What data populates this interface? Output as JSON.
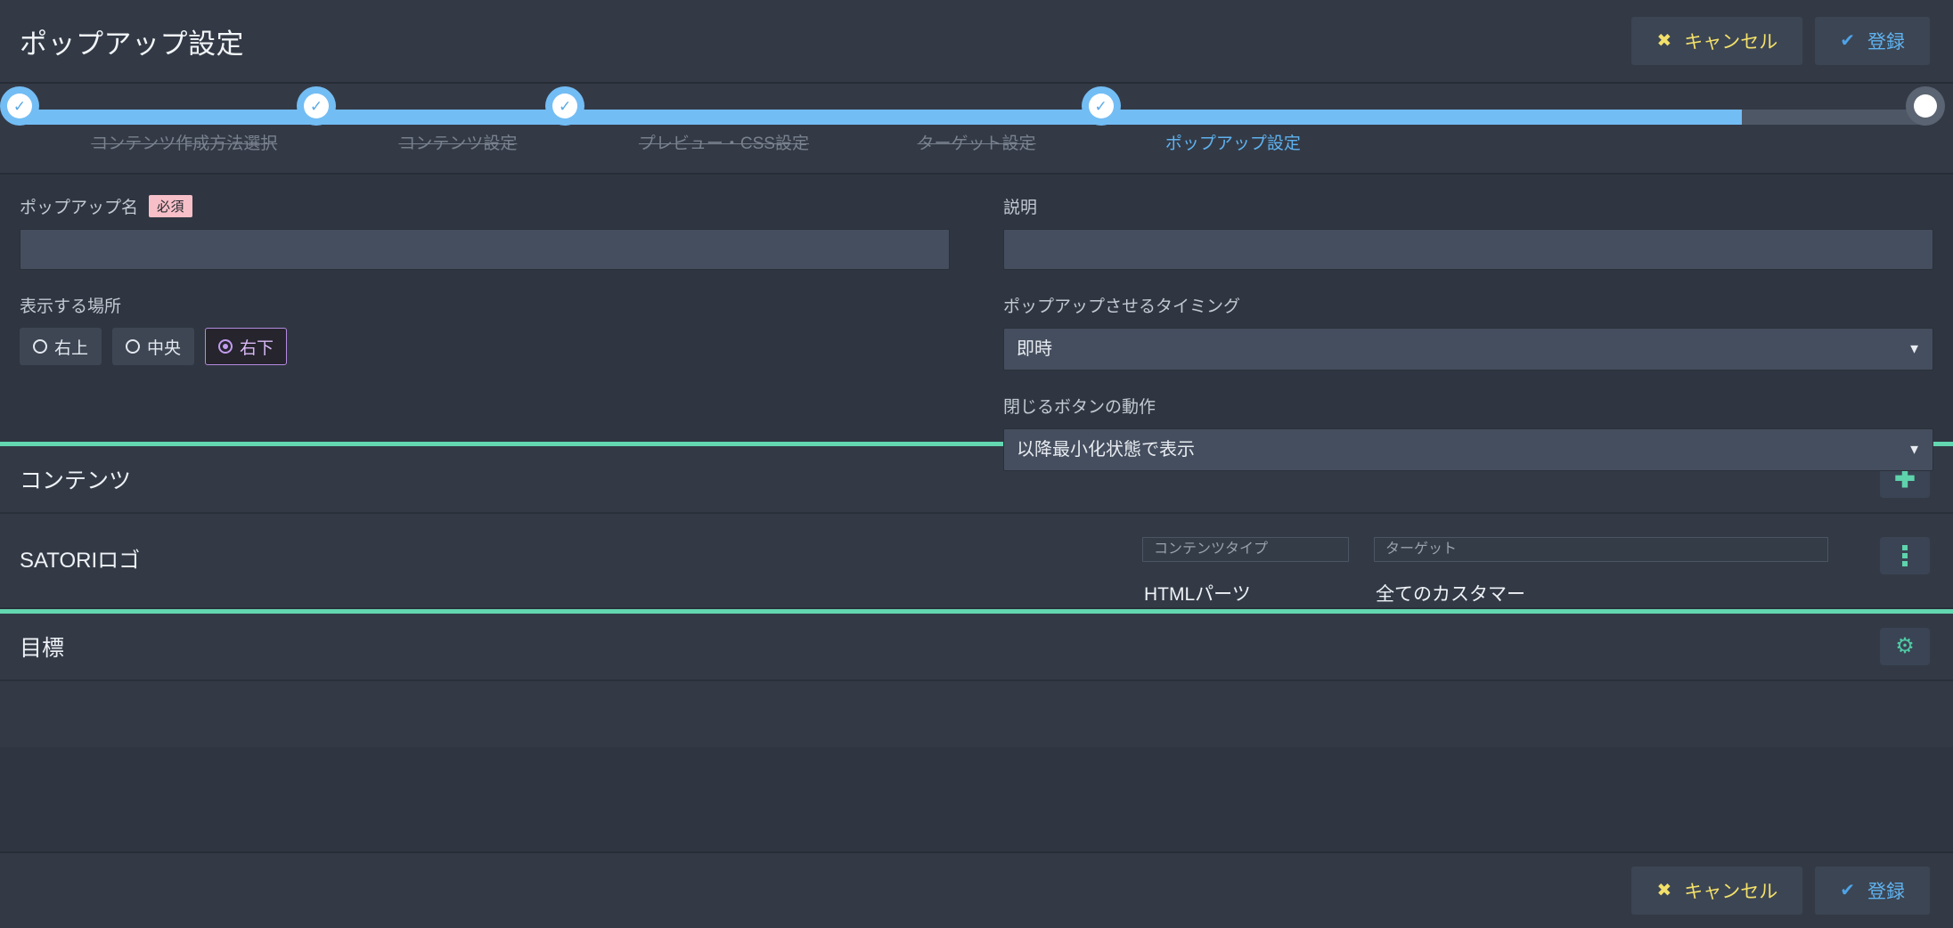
{
  "header": {
    "title": "ポップアップ設定",
    "cancel_label": "キャンセル",
    "submit_label": "登録",
    "cancel_icon": "cross-icon",
    "submit_icon": "check-icon"
  },
  "stepper": {
    "steps": [
      {
        "label": "コンテンツ作成方法選択",
        "state": "done"
      },
      {
        "label": "コンテンツ設定",
        "state": "done"
      },
      {
        "label": "プレビュー・CSS設定",
        "state": "done"
      },
      {
        "label": "ターゲット設定",
        "state": "done"
      },
      {
        "label": "ポップアップ設定",
        "state": "current"
      }
    ],
    "progress_percent": 90,
    "fill_color": "#73bdf5",
    "track_color": "#4e5765",
    "active_color": "#5fb2ef"
  },
  "form": {
    "popup_name": {
      "label": "ポップアップ名",
      "required_badge": "必須",
      "value": "",
      "placeholder": ""
    },
    "description": {
      "label": "説明",
      "value": "",
      "placeholder": ""
    },
    "display_position": {
      "label": "表示する場所",
      "options": [
        {
          "label": "右上",
          "selected": false
        },
        {
          "label": "中央",
          "selected": false
        },
        {
          "label": "右下",
          "selected": true
        }
      ],
      "selected_color": "#b58ae0"
    },
    "timing": {
      "label": "ポップアップさせるタイミング",
      "value": "即時"
    },
    "close_action": {
      "label": "閉じるボタンの動作",
      "value": "以降最小化状態で表示"
    }
  },
  "sections": {
    "content": {
      "title": "コンテンツ",
      "add_icon": "plus-icon",
      "divider_color": "#63d7b0",
      "rows": [
        {
          "name": "SATORIロゴ",
          "content_type_caption": "コンテンツタイプ",
          "content_type_value": "HTMLパーツ",
          "target_caption": "ターゲット",
          "target_value": "全てのカスタマー",
          "menu_icon": "kebab-menu-icon"
        }
      ]
    },
    "goal": {
      "title": "目標",
      "settings_icon": "gear-icon",
      "divider_color": "#63d7b0"
    }
  },
  "footer": {
    "cancel_label": "キャンセル",
    "submit_label": "登録",
    "cancel_icon": "cross-icon",
    "submit_icon": "check-icon"
  },
  "glyphs": {
    "cross": "✖",
    "check": "✔",
    "plus": "✚",
    "gear": "⚙",
    "caret_down": "▼",
    "tick": "✓"
  }
}
